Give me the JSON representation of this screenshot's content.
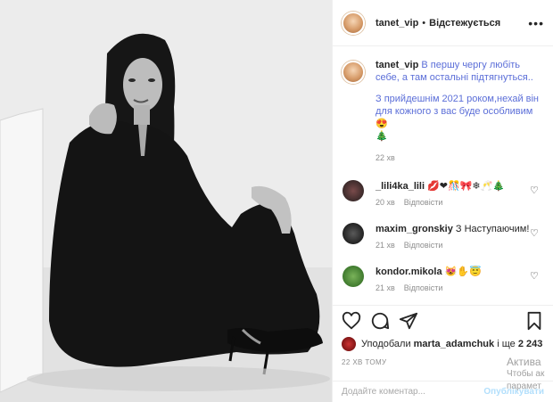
{
  "post": {
    "username": "tanet_vip",
    "follow_status": "Відстежується",
    "caption_line1": "В першу чергу любіть себе, а там остальні підтягнуться..",
    "caption_line2": "З прийдешнім 2021 роком,нехай він для кожного з вас буде особливим",
    "caption_emoji": "😍",
    "caption_tree": "🎄",
    "caption_time": "22 хв"
  },
  "comments": [
    {
      "user": "_lili4ka_lili",
      "text": "💋❤🎊🎀❄🥂🎄",
      "time": "20 хв",
      "reply": "Відповісти"
    },
    {
      "user": "maxim_gronskiy",
      "text": "З Наступаючим!",
      "time": "21 хв",
      "reply": "Відповісти"
    },
    {
      "user": "kondor.mikola",
      "text": "😻✋😇",
      "time": "21 хв",
      "reply": "Відповісти"
    }
  ],
  "likes": {
    "prefix": "Уподобали",
    "user": "marta_adamchuk",
    "middle": "і ще",
    "count": "2 243"
  },
  "time_ago": "22 ХВ ТОМУ",
  "add_comment": {
    "placeholder": "Додайте коментар...",
    "post_label": "Опублікувати"
  },
  "watermark": {
    "line1": "Актива",
    "line2": "Чтобы ак",
    "line3": "парамет"
  },
  "icons": {
    "more": "more-horizontal-icon",
    "like": "heart-icon",
    "comment": "comment-icon",
    "share": "paper-plane-icon",
    "save": "bookmark-icon"
  }
}
